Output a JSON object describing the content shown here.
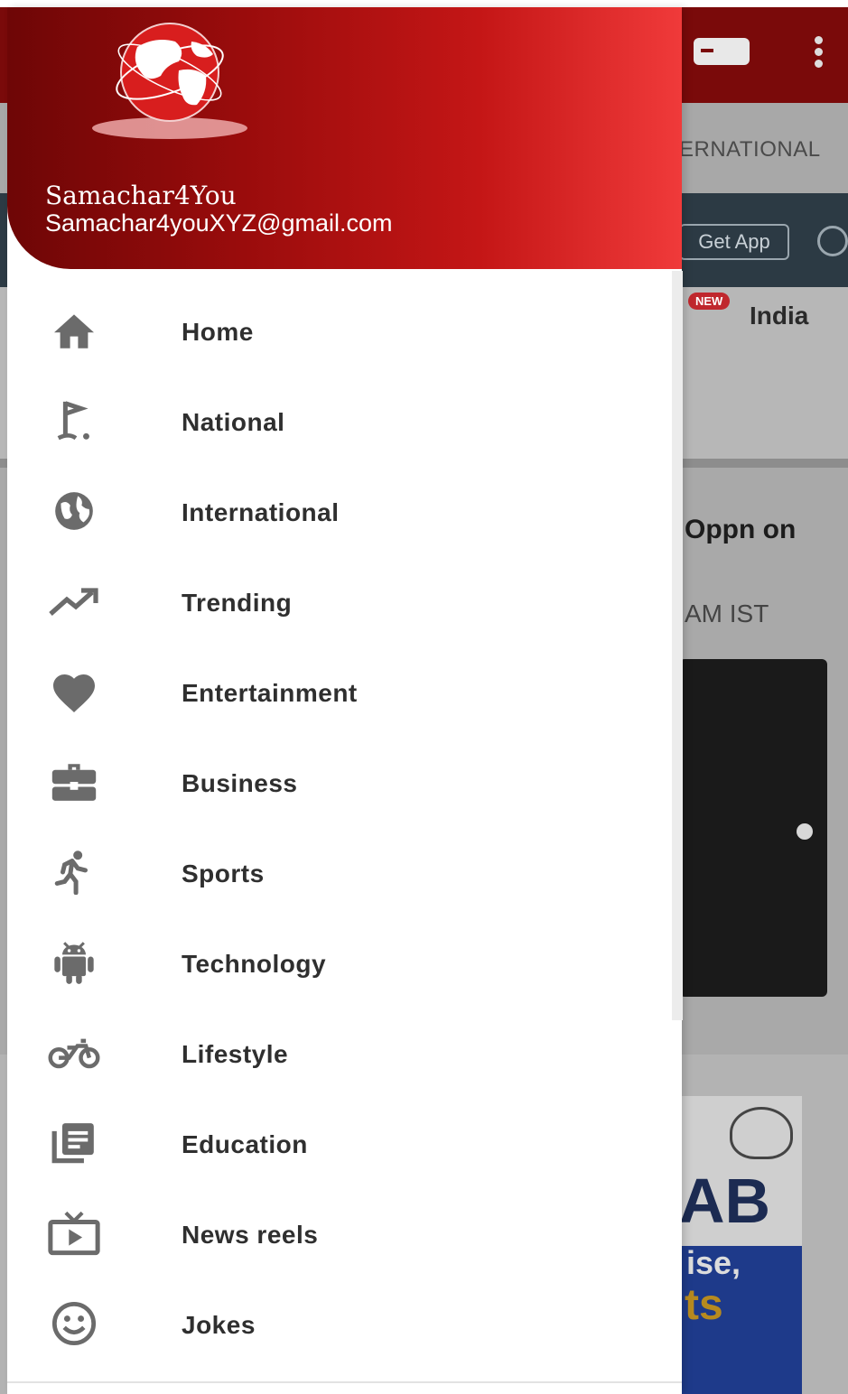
{
  "header": {
    "app_name": "Samachar4You",
    "email": "Samachar4youXYZ@gmail.com"
  },
  "menu": [
    {
      "label": "Home",
      "icon": "home-icon"
    },
    {
      "label": "National",
      "icon": "flag-icon"
    },
    {
      "label": "International",
      "icon": "globe-icon"
    },
    {
      "label": "Trending",
      "icon": "trending-up-icon"
    },
    {
      "label": "Entertainment",
      "icon": "heart-icon"
    },
    {
      "label": "Business",
      "icon": "briefcase-icon"
    },
    {
      "label": "Sports",
      "icon": "running-icon"
    },
    {
      "label": "Technology",
      "icon": "android-icon"
    },
    {
      "label": "Lifestyle",
      "icon": "bike-icon"
    },
    {
      "label": "Education",
      "icon": "library-books-icon"
    },
    {
      "label": "News reels",
      "icon": "tv-play-icon"
    },
    {
      "label": "Jokes",
      "icon": "smiley-icon"
    }
  ],
  "background": {
    "tab_partial": "ERNATIONAL",
    "get_app": "Get App",
    "new_badge": "NEW",
    "category": "India",
    "headline_partial": "Oppn on",
    "time_partial": "AM IST",
    "ad_text_1": "AB",
    "ad_text_2": "ise,",
    "ad_text_3": "ts"
  },
  "colors": {
    "header_start": "#6e0606",
    "header_end": "#f03a3a",
    "icon_gray": "#6b6b6b",
    "label_text": "#2f2f2f"
  }
}
